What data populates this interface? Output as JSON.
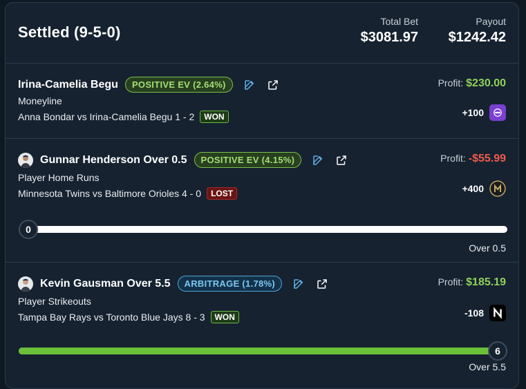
{
  "header": {
    "title": "Settled (9-5-0)",
    "total_bet_label": "Total Bet",
    "total_bet_value": "$3081.97",
    "payout_label": "Payout",
    "payout_value": "$1242.42"
  },
  "bets": [
    {
      "name": "Irina-Camelia Begu",
      "tag": "POSITIVE EV (2.64%)",
      "market": "Moneyline",
      "matchup": "Anna Bondar vs Irina-Camelia Begu 1 - 2",
      "result": "WON",
      "profit_label": "Profit:",
      "profit": "$230.00",
      "odds": "+100",
      "book": "hard-rock-bet-icon"
    },
    {
      "name": "Gunnar Henderson Over 0.5",
      "tag": "POSITIVE EV (4.15%)",
      "market": "Player Home Runs",
      "matchup": "Minnesota Twins vs Baltimore Orioles 4 - 0",
      "result": "LOST",
      "profit_label": "Profit:",
      "profit": "-$55.99",
      "odds": "+400",
      "book": "betmgm-icon",
      "progress_value": "0",
      "progress_fraction": 0.0,
      "line_label": "Over 0.5"
    },
    {
      "name": "Kevin Gausman Over 5.5",
      "tag": "ARBITRAGE (1.78%)",
      "market": "Player Strikeouts",
      "matchup": "Tampa Bay Rays vs Toronto Blue Jays 8 - 3",
      "result": "WON",
      "profit_label": "Profit:",
      "profit": "$185.19",
      "odds": "-108",
      "book": "novig-icon",
      "progress_value": "6",
      "progress_fraction": 1.0,
      "line_label": "Over 5.5"
    }
  ],
  "colors": {
    "positive": "#8fd15a",
    "negative": "#ef5b4e",
    "ev_accent": "#7cc24a",
    "arb_accent": "#4fa7dc",
    "track_empty": "#ffffff",
    "track_fill": "#6cc03a"
  }
}
